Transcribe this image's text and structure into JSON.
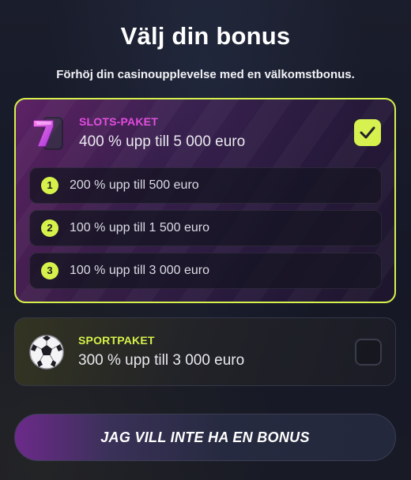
{
  "header": {
    "title": "Välj din bonus",
    "subtitle": "Förhöj din casinoupplevelse med en välkomstbonus."
  },
  "packages": [
    {
      "label": "SLOTS-PAKET",
      "amount": "400 % upp till 5 000 euro",
      "icon": "slot-seven-icon",
      "selected": true,
      "tiers": [
        {
          "number": "1",
          "text": "200 % upp till 500 euro"
        },
        {
          "number": "2",
          "text": "100 % upp till 1 500 euro"
        },
        {
          "number": "3",
          "text": "100 % upp till 3 000 euro"
        }
      ]
    },
    {
      "label": "SPORTPAKET",
      "amount": "300 % upp till 3 000 euro",
      "icon": "soccer-ball-icon",
      "selected": false
    }
  ],
  "cta": {
    "label": "JAG VILL INTE HA EN BONUS"
  },
  "colors": {
    "accent": "#d6f24a",
    "slots_label": "#e24ae0",
    "background": "#1a1d2b"
  }
}
